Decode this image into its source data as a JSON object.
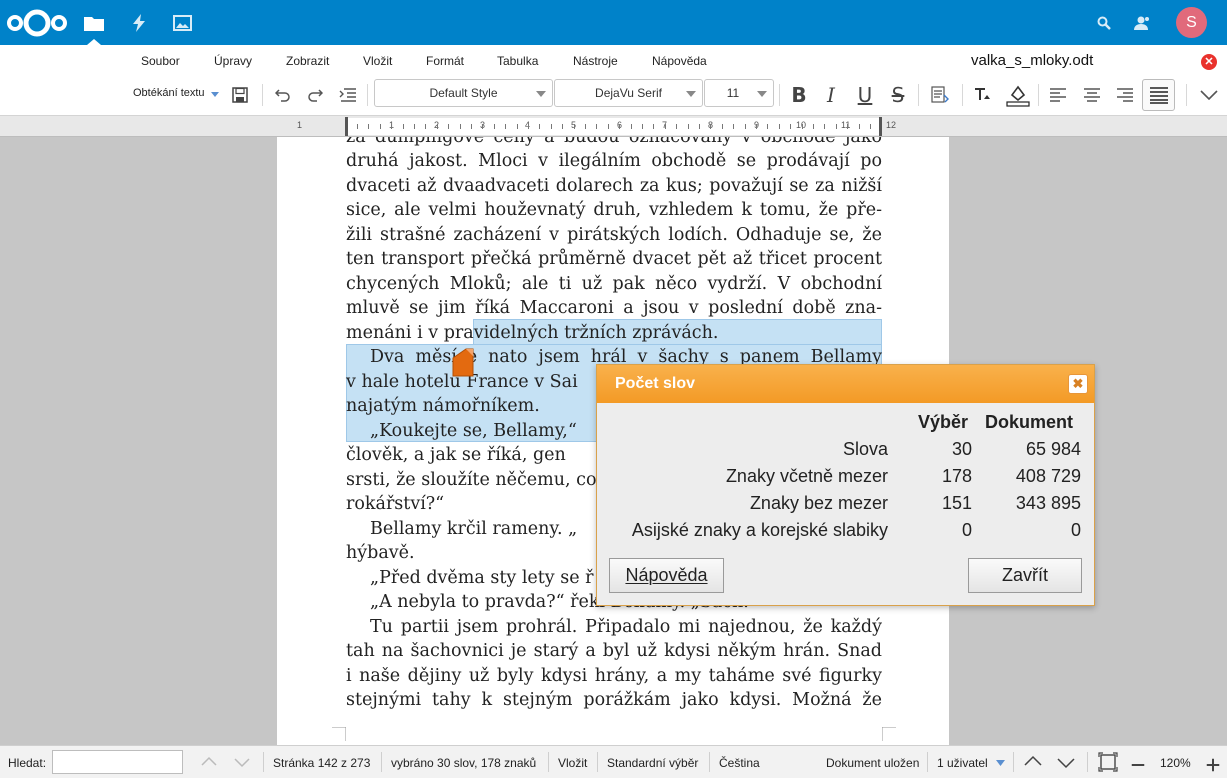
{
  "topbar": {
    "logo": "nextcloud-logo",
    "apps": [
      "files-icon",
      "activity-icon",
      "gallery-icon"
    ],
    "search_icon": "search-icon",
    "contacts_icon": "contacts-icon",
    "avatar_initial": "S",
    "avatar_color": "#e16a7b",
    "brand_color": "#0082c9"
  },
  "menubar": {
    "items": [
      "Soubor",
      "Úpravy",
      "Zobrazit",
      "Vložit",
      "Formát",
      "Tabulka",
      "Nástroje",
      "Nápověda"
    ],
    "document_title": "valka_s_mloky.odt"
  },
  "toolbar": {
    "wrap_label": "Obtékání textu",
    "paragraph_style": "Default Style",
    "font_name": "DejaVu Serif",
    "font_size": "11"
  },
  "ruler": {
    "numbers": [
      "1",
      "1",
      "2",
      "3",
      "4",
      "5",
      "6",
      "7",
      "8",
      "9",
      "10",
      "11",
      "12"
    ]
  },
  "document": {
    "lines": [
      "za dumpingové ceny a budou označovány v obchodě jako",
      "druhá jakost. Mloci v ilegálním obchodě se prodávají po",
      "dvaceti až dvaadvaceti dolarech za kus; považují se za nižší",
      "sice, ale velmi houževnatý druh, vzhledem k tomu, že pře-",
      "žili strašné zacházení v pirátských lodích. Odhaduje se, že",
      "ten transport přečká průměrně dvacet pět až třicet procent",
      "chycených Mloků; ale ti už pak něco vydrží. V obchodní",
      "mluvě se jim říká Maccaroni a jsou v poslední době zna-",
      "menáni i v pravidelných tržních zprávách.",
      "Dva měsíce nato jsem hrál v šachy s panem Bellamy",
      "v hale hotelu France v Sai",
      "najatým námořníkem.",
      "„Koukejte se, Bellamy,“",
      "člověk, a jak se říká, gen",
      "srsti, že sloužíte něčemu, co",
      "rokářství?“",
      "Bellamy krčil rameny. „",
      "hýbavě.",
      "„Před dvěma sty lety se ř",
      "„A nebyla to pravda?“ řekl Bellamy. „Šach.“",
      "Tu partii jsem prohrál. Připadalo mi najednou, že každý",
      "tah na šachovnici je starý a byl už kdysi někým hrán. Snad",
      "i naše dějiny už byly kdysi hrány, a my taháme své figurky",
      "stejnými tahy k stejným porážkám jako kdysi. Možná že"
    ]
  },
  "dialog": {
    "title": "Počet slov",
    "col_selection": "Výběr",
    "col_document": "Dokument",
    "rows": [
      {
        "label": "Slova",
        "selection": "30",
        "document": "65 984"
      },
      {
        "label": "Znaky včetně mezer",
        "selection": "178",
        "document": "408 729"
      },
      {
        "label": "Znaky bez mezer",
        "selection": "151",
        "document": "343 895"
      },
      {
        "label": "Asijské znaky a korejské slabiky",
        "selection": "0",
        "document": "0"
      }
    ],
    "help_button": "Nápověda",
    "close_button": "Zavřít",
    "accent_color": "#f5a233"
  },
  "statusbar": {
    "find_label": "Hledat:",
    "page": "Stránka 142 z 273",
    "selection_info": "vybráno 30 slov, 178 znaků",
    "insert_mode": "Vložit",
    "selection_mode": "Standardní výběr",
    "language": "Čeština",
    "save_state": "Dokument uložen",
    "users": "1 uživatel",
    "zoom": "120%"
  }
}
